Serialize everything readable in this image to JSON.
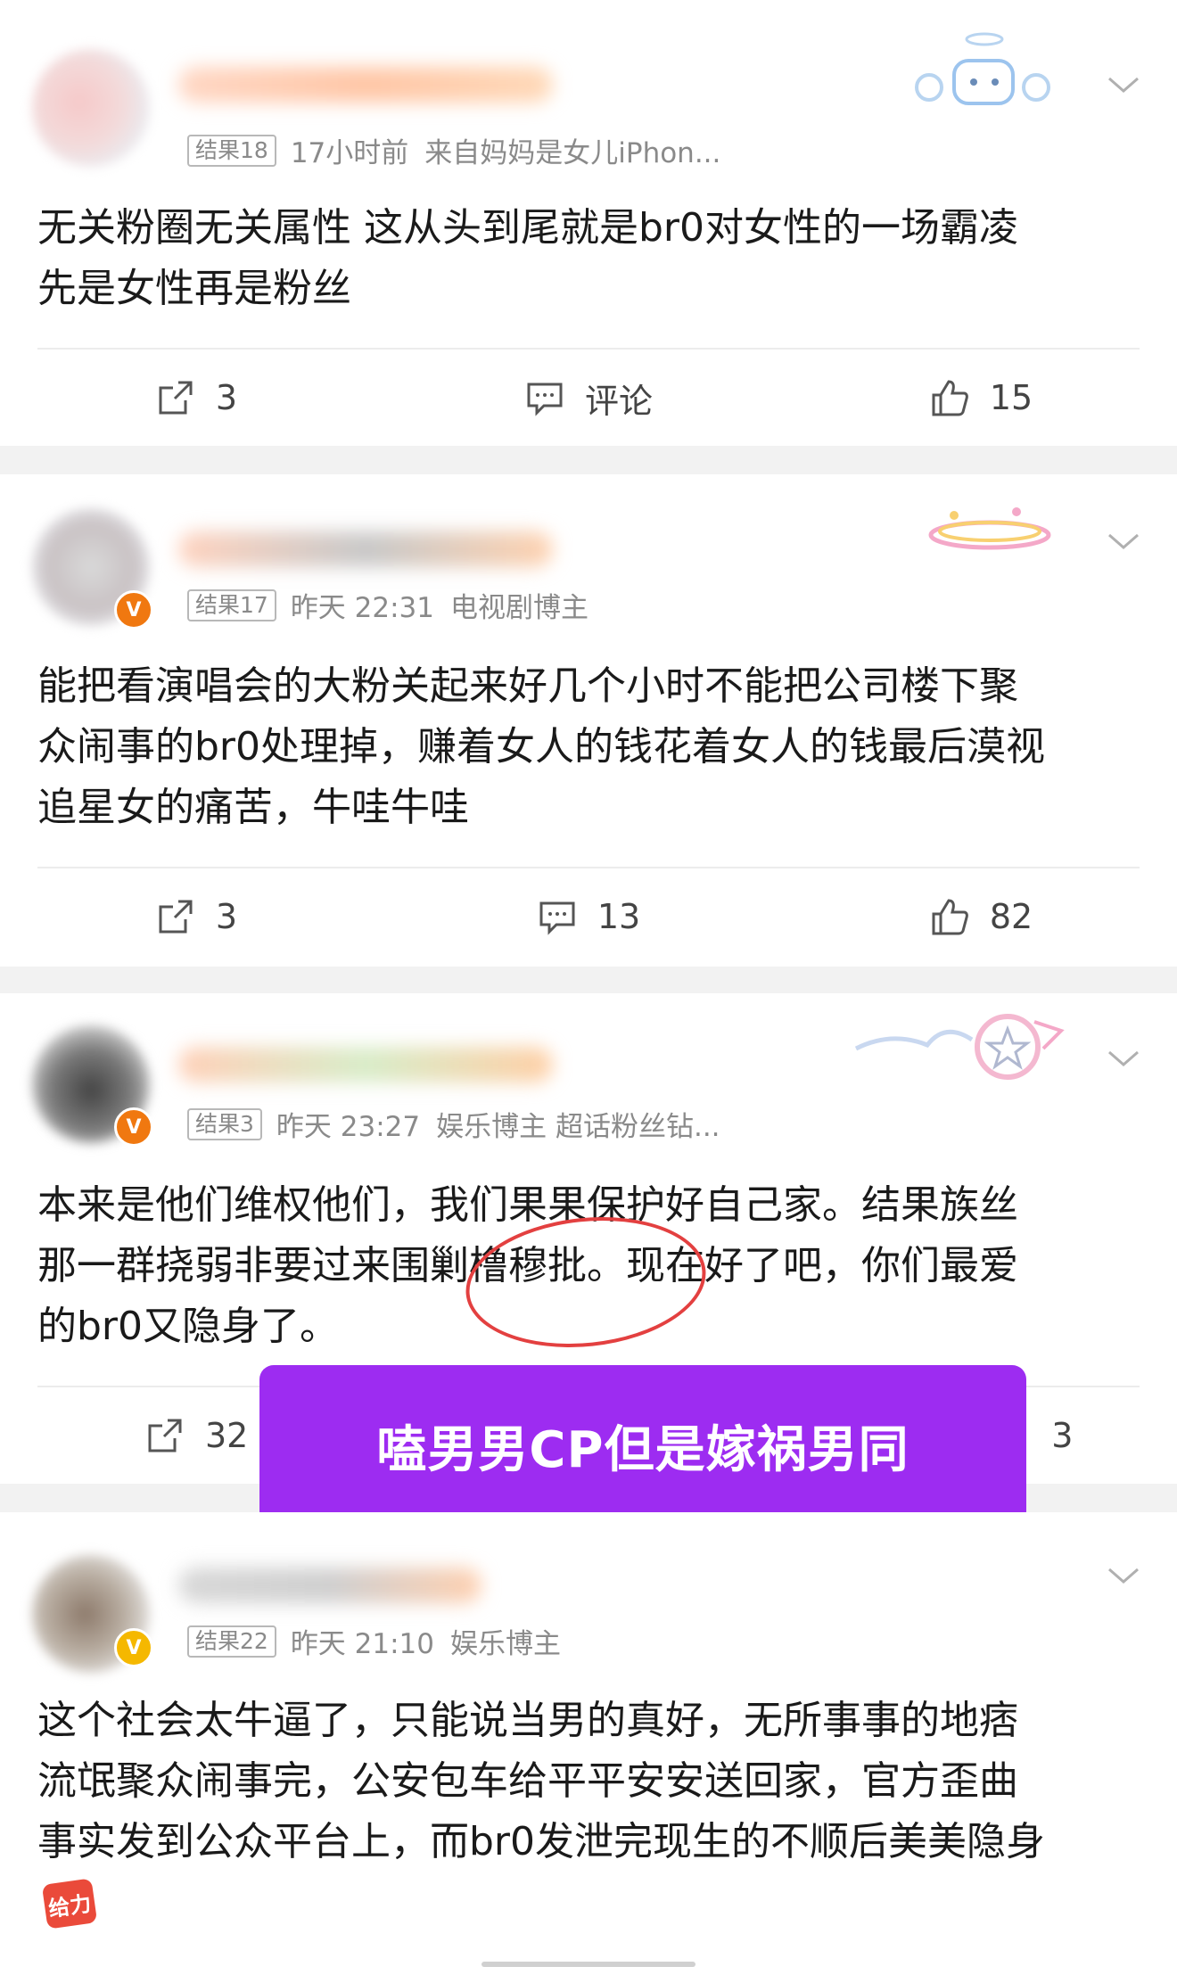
{
  "posts": [
    {
      "tag": "结果18",
      "time": "17小时前",
      "source": "来自妈妈是女儿iPhon...",
      "content_lines": [
        "无关粉圈无关属性 这从头到尾就是br0对女性的一场霸凌",
        "先是女性再是粉丝"
      ],
      "repost": "3",
      "comment": "评论",
      "like": "15"
    },
    {
      "tag": "结果17",
      "time": "昨天 22:31",
      "source": "电视剧博主",
      "content_lines": [
        "能把看演唱会的大粉关起来好几个小时不能把公司楼下聚",
        "众闹事的br0处理掉，赚着女人的钱花着女人的钱最后漠视",
        "追星女的痛苦，牛哇牛哇"
      ],
      "repost": "3",
      "comment": "13",
      "like": "82"
    },
    {
      "tag": "结果3",
      "time": "昨天 23:27",
      "source": "娱乐博主 超话粉丝钻...",
      "content_lines": [
        "本来是他们维权他们，我们果果保护好自己家。结果族丝",
        "那一群挠弱非要过来围剿橹穆批。现在好了吧，你们最爱",
        "的br0又隐身了。"
      ],
      "repost": "32",
      "comment": "",
      "like": "3"
    },
    {
      "tag": "结果22",
      "time": "昨天 21:10",
      "source": "娱乐博主",
      "content_lines": [
        "这个社会太牛逼了，只能说当男的真好，无所事事的地痞",
        "流氓聚众闹事完，公安包车给平平安安送回家，官方歪曲",
        "事实发到公众平台上，而br0发泄完现生的不顺后美美隐身"
      ]
    }
  ],
  "overlay_text": "嗑男男CP但是嫁祸男同",
  "emoji_label": "给力",
  "verified_mark": "V",
  "colors": {
    "overlay": "#9d2cf1",
    "verified_orange": "#f07810",
    "verified_yellow": "#f5b800"
  }
}
